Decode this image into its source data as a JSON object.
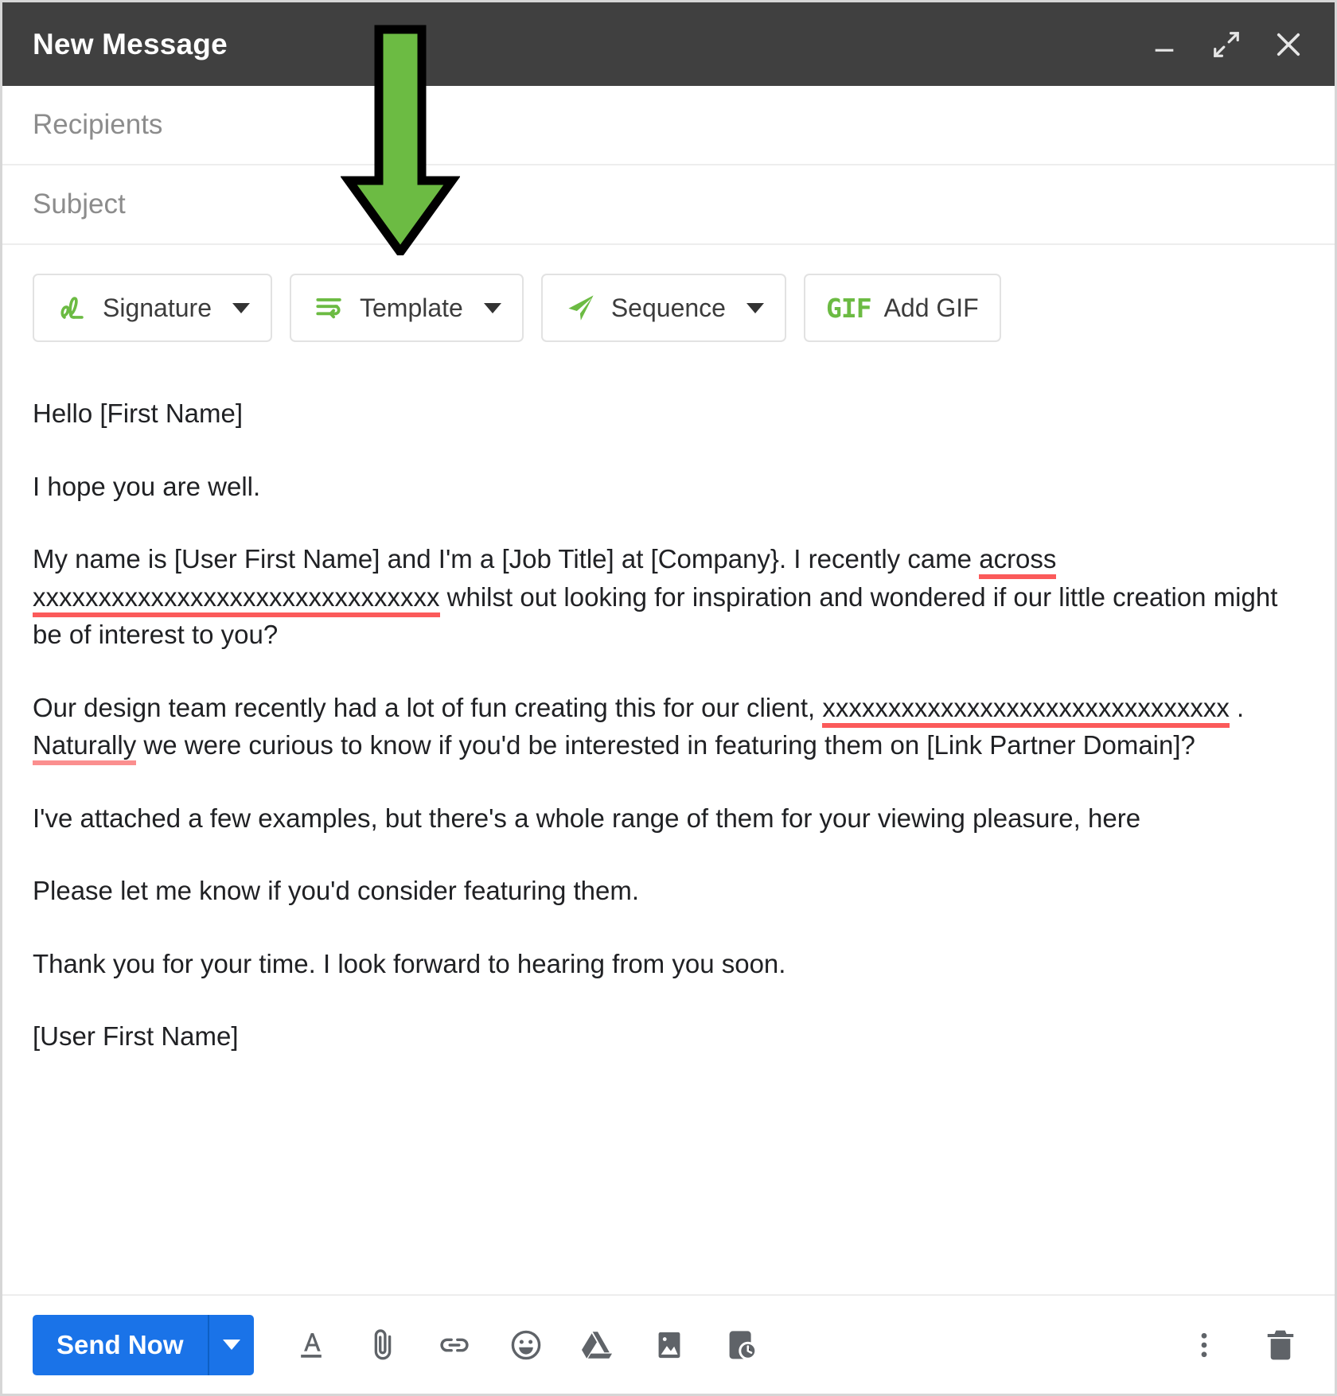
{
  "window": {
    "title": "New Message",
    "controls": [
      {
        "name": "minimize-button",
        "icon": "minimize-icon"
      },
      {
        "name": "expand-button",
        "icon": "expand-arrows-icon"
      },
      {
        "name": "close-button",
        "icon": "close-x-icon"
      }
    ]
  },
  "fields": {
    "recipients_placeholder": "Recipients",
    "subject_placeholder": "Subject"
  },
  "toolbar": {
    "signature_label": "Signature",
    "template_label": "Template",
    "sequence_label": "Sequence",
    "gif_mark": "GIF",
    "add_gif_label": "Add GIF",
    "icons": {
      "signature": "signature-squiggle-icon",
      "template": "template-lines-icon",
      "sequence": "paper-plane-icon",
      "gif": "gif-icon"
    },
    "accent_green": "#6cbb43"
  },
  "body": {
    "greeting": "Hello [First Name]",
    "p_hope": "I hope you are well.",
    "p_intro_a": "My name is [User First Name] and I'm a [Job Title] at [Company}. I recently came ",
    "p_intro_across": "across",
    "p_intro_xs": "xxxxxxxxxxxxxxxxxxxxxxxxxxxxxxx",
    "p_intro_b": " whilst out looking for inspiration and wondered if our little creation might be of interest to you?",
    "p_design_a": "Our design team recently had a lot of fun creating this for our client, ",
    "p_design_xs": "xxxxxxxxxxxxxxxxxxxxxxxxxxxxxxx",
    "p_design_dot": " . ",
    "p_design_naturally": "Naturally",
    "p_design_b": " we were curious to know if you'd be interested in featuring them on [Link Partner Domain]?",
    "p_attached": "I've attached a few examples, but there's a whole range of them for your viewing pleasure, here",
    "p_please": "Please let me know if you'd consider featuring them.",
    "p_thanks": "Thank you for your time. I look forward to hearing from you soon.",
    "p_signoff": "[User First Name]",
    "spellcheck_color": "#fb5a5a",
    "spellcheck_color_light": "#fb8f8f"
  },
  "footer": {
    "send_label": "Send Now",
    "send_color": "#1a73e8",
    "icons": [
      {
        "name": "format-text-icon",
        "label": "A"
      },
      {
        "name": "attach-file-icon",
        "label": "paperclip"
      },
      {
        "name": "insert-link-icon",
        "label": "link"
      },
      {
        "name": "insert-emoji-icon",
        "label": "emoji"
      },
      {
        "name": "google-drive-icon",
        "label": "drive"
      },
      {
        "name": "insert-photo-icon",
        "label": "image"
      },
      {
        "name": "schedule-send-icon",
        "label": "schedule"
      }
    ],
    "right_icons": [
      {
        "name": "more-options-icon",
        "label": "more"
      },
      {
        "name": "discard-draft-icon",
        "label": "trash"
      }
    ]
  },
  "annotation": {
    "arrow_name": "green-down-arrow-annotation",
    "arrow_fill": "#6cbb43",
    "arrow_stroke": "#000000",
    "points_to": "Template"
  }
}
